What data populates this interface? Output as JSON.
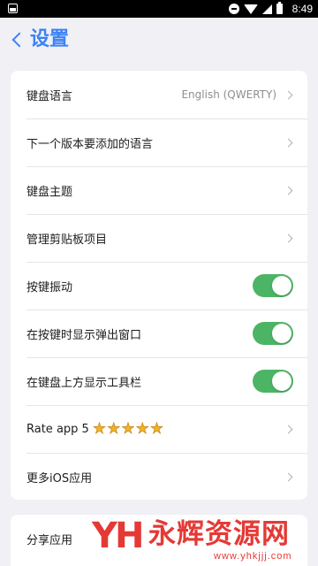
{
  "status_bar": {
    "time": "8:49"
  },
  "nav": {
    "back_label": "设置"
  },
  "settings": {
    "language": {
      "label": "键盘语言",
      "value": "English (QWERTY)"
    },
    "upcoming_languages": {
      "label": "下一个版本要添加的语言"
    },
    "theme": {
      "label": "键盘主题"
    },
    "clipboard": {
      "label": "管理剪贴板项目"
    },
    "vibration": {
      "label": "按键振动",
      "enabled": true
    },
    "popup": {
      "label": "在按键时显示弹出窗口",
      "enabled": true
    },
    "toolbar": {
      "label": "在键盘上方显示工具栏",
      "enabled": true
    },
    "rate": {
      "label": "Rate app 5",
      "stars": 5
    },
    "more_ios": {
      "label": "更多iOS应用"
    }
  },
  "share": {
    "label": "分享应用"
  },
  "watermark": {
    "name": "永辉资源网",
    "url": "www.yhkjjj.com",
    "logo": "YH"
  },
  "colors": {
    "accent": "#3b82f6",
    "toggle_on": "#4cb565",
    "star": "#f0b323",
    "watermark": "#e53935"
  }
}
